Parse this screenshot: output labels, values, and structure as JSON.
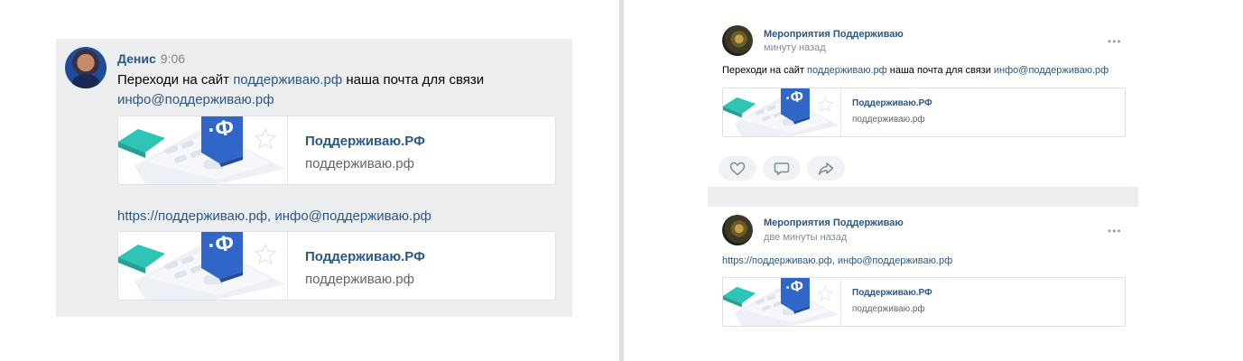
{
  "colors": {
    "link": "#2a5885",
    "panel_bg": "#edeef0",
    "card_border": "#dce1e6"
  },
  "message": {
    "author": "Денис",
    "time": "9:06",
    "text_prefix": "Переходи на сайт ",
    "text_link": "поддерживаю.рф",
    "text_middle": " наша почта для связи ",
    "text_email": "инфо@поддерживаю.рф",
    "second_text": "https://поддерживаю.рф, инфо@поддерживаю.рф",
    "cards": [
      {
        "title": "Поддерживаю.РФ",
        "domain": "поддерживаю.рф"
      },
      {
        "title": "Поддерживаю.РФ",
        "domain": "поддерживаю.рф"
      }
    ]
  },
  "feed": {
    "posts": [
      {
        "author": "Мероприятия Поддерживаю",
        "time": "минуту назад",
        "more": "•••",
        "text_prefix": "Переходи на сайт ",
        "text_link": "поддерживаю.рф",
        "text_middle": " наша почта для связи ",
        "text_email": "инфо@поддерживаю.рф",
        "card": {
          "title": "Поддерживаю.РФ",
          "domain": "поддерживаю.рф"
        },
        "actions": [
          "heart-icon",
          "comment-icon",
          "share-icon"
        ]
      },
      {
        "author": "Мероприятия Поддерживаю",
        "time": "две минуты назад",
        "more": "•••",
        "text": "https://поддерживаю.рф, инфо@поддерживаю.рф",
        "card": {
          "title": "Поддерживаю.РФ",
          "domain": "поддерживаю.рф"
        }
      }
    ]
  }
}
